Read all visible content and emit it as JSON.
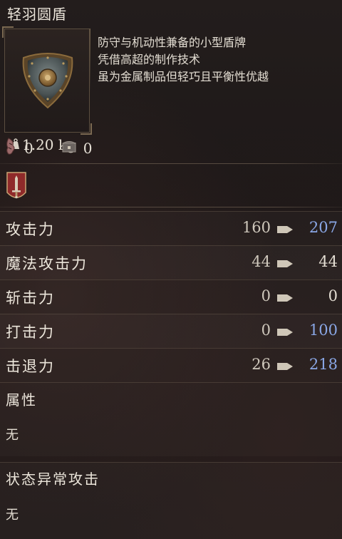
{
  "item": {
    "name": "轻羽圆盾",
    "weight": "1.20 kg",
    "icon": "round-shield-icon",
    "description": [
      "防守与机动性兼备的小型盾牌",
      "凭借高超的制作技术",
      "虽为金属制品但轻巧且平衡性优越"
    ]
  },
  "substats": [
    {
      "icon": "bleed-icon",
      "value": "0"
    },
    {
      "icon": "chest-icon",
      "value": "0"
    }
  ],
  "weapon_type_icon": "sword-emblem-icon",
  "stats": [
    {
      "label": "攻击力",
      "base": "160",
      "new": "207",
      "improved": true
    },
    {
      "label": "魔法攻击力",
      "base": "44",
      "new": "44",
      "improved": false
    },
    {
      "label": "斩击力",
      "base": "0",
      "new": "0",
      "improved": false
    },
    {
      "label": "打击力",
      "base": "0",
      "new": "100",
      "improved": true
    },
    {
      "label": "击退力",
      "base": "26",
      "new": "218",
      "improved": true
    }
  ],
  "attribute": {
    "label": "属性",
    "value": "无"
  },
  "status_attack": {
    "label": "状态异常攻击",
    "value": "无"
  },
  "colors": {
    "improved": "#8aa7e6",
    "text": "#e6e0d6",
    "emblem_red": "#9b2b2b"
  }
}
